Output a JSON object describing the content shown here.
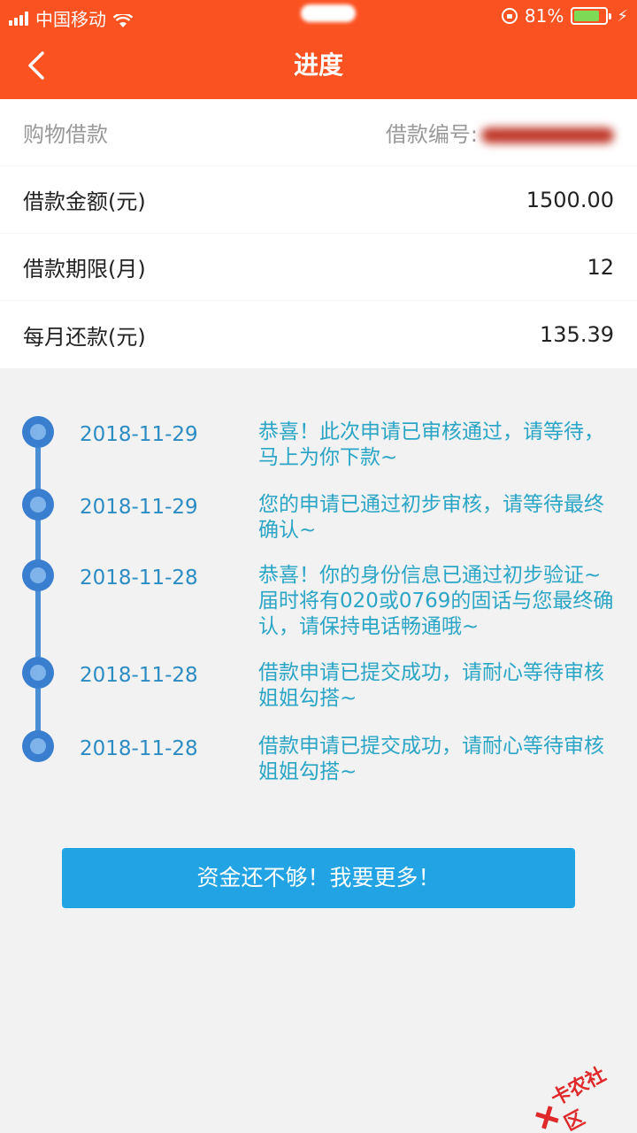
{
  "status_bar": {
    "carrier": "中国移动",
    "battery_percent": "81%",
    "battery_level": 0.81,
    "accent_color": "#fb5221"
  },
  "header": {
    "title": "进度",
    "back_icon": "chevron-left-icon"
  },
  "loan": {
    "type": "购物借款",
    "number_label": "借款编号:",
    "rows": [
      {
        "label": "借款金额(元)",
        "value": "1500.00"
      },
      {
        "label": "借款期限(月)",
        "value": "12"
      },
      {
        "label": "每月还款(元)",
        "value": "135.39"
      }
    ]
  },
  "timeline": [
    {
      "date": "2018-11-29",
      "message": "恭喜！此次申请已审核通过，请等待，马上为你下款~"
    },
    {
      "date": "2018-11-29",
      "message": "您的申请已通过初步审核，请等待最终确认~"
    },
    {
      "date": "2018-11-28",
      "message": "恭喜！你的身份信息已通过初步验证~届时将有020或0769的固话与您最终确认，请保持电话畅通哦~"
    },
    {
      "date": "2018-11-28",
      "message": "借款申请已提交成功，请耐心等待审核姐姐勾搭~"
    },
    {
      "date": "2018-11-28",
      "message": "借款申请已提交成功，请耐心等待审核姐姐勾搭~"
    }
  ],
  "cta_label": "资金还不够！我要更多！",
  "watermark": "卡农社区"
}
